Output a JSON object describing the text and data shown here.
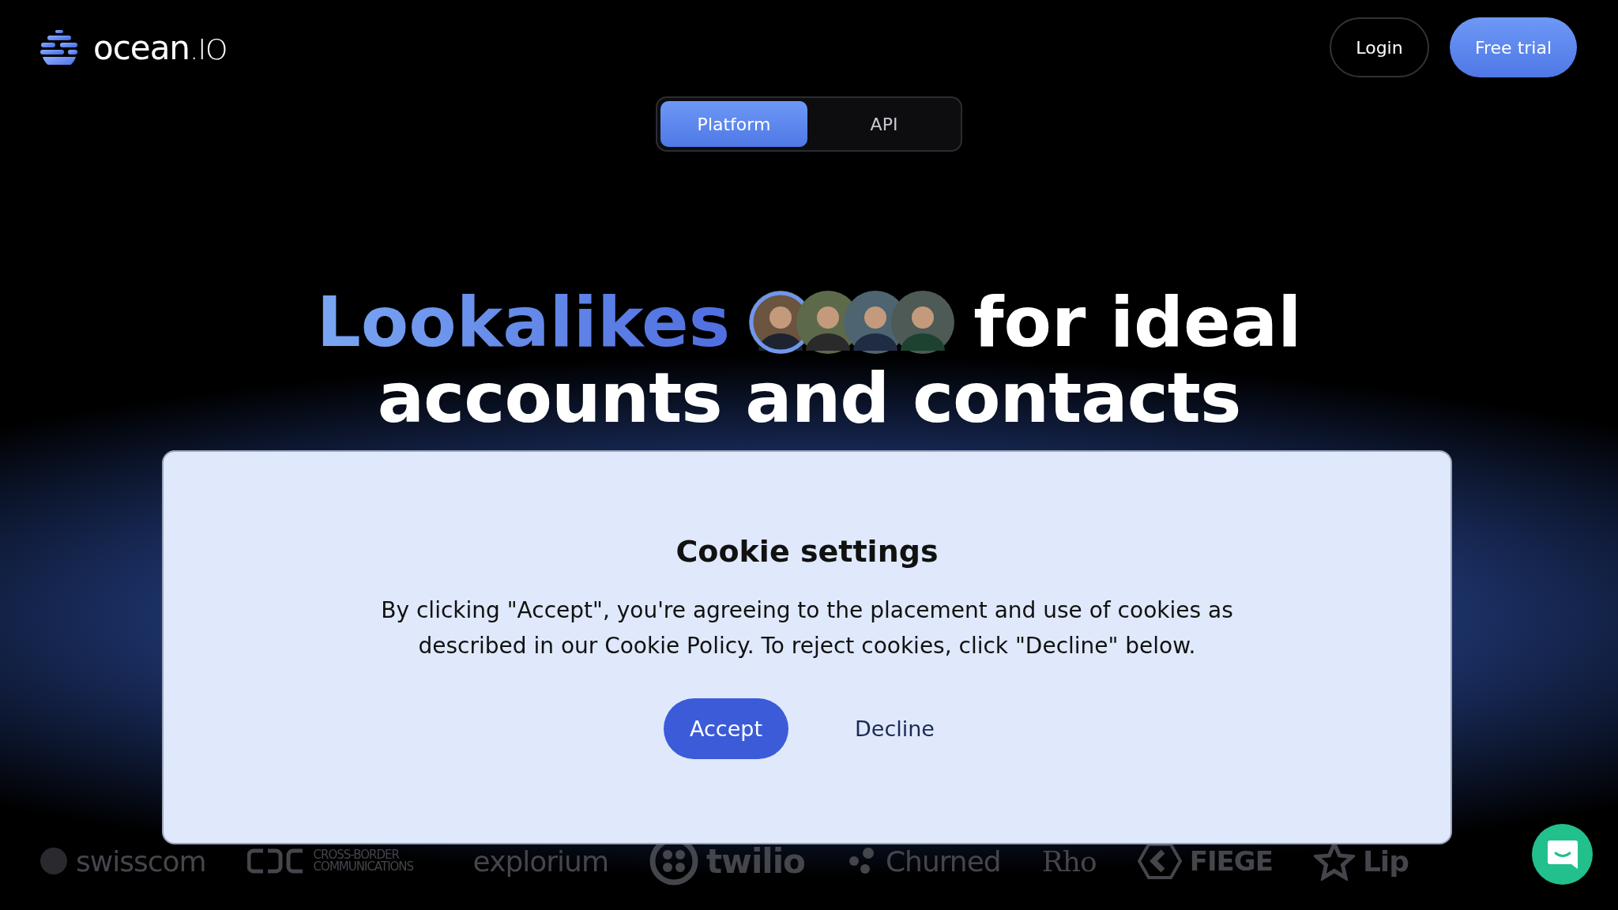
{
  "header": {
    "logo_text": "ocean",
    "logo_suffix": ".IO",
    "buttons": [
      {
        "label": "Login",
        "kind": "outline"
      },
      {
        "label": "Free trial",
        "kind": "primary"
      }
    ]
  },
  "tabs": [
    {
      "label": "Platform",
      "selected": true
    },
    {
      "label": "API",
      "selected": false
    }
  ],
  "headline": {
    "highlight": "Lookalikes",
    "rest_line1": "for ideal",
    "line2": "accounts and contacts",
    "avatars": [
      {
        "selected": true
      },
      {
        "selected": false
      },
      {
        "selected": false
      },
      {
        "selected": false
      }
    ]
  },
  "cookie_dialog": {
    "title": "Cookie settings",
    "body": "By clicking \"Accept\", you're agreeing to the placement and use of cookies as described in our Cookie Policy. To reject cookies, click \"Decline\" below.",
    "buttons": [
      {
        "label": "Accept",
        "kind": "primary"
      },
      {
        "label": "Decline",
        "kind": "text"
      }
    ]
  },
  "logos": [
    {
      "name": "swisscom"
    },
    {
      "name": "CROSS-BORDER COMMUNICATIONS"
    },
    {
      "name": "explorium"
    },
    {
      "name": "twilio"
    },
    {
      "name": "Churned"
    },
    {
      "name": "Rho"
    },
    {
      "name": "FIEGE"
    },
    {
      "name": "Lip"
    }
  ]
}
